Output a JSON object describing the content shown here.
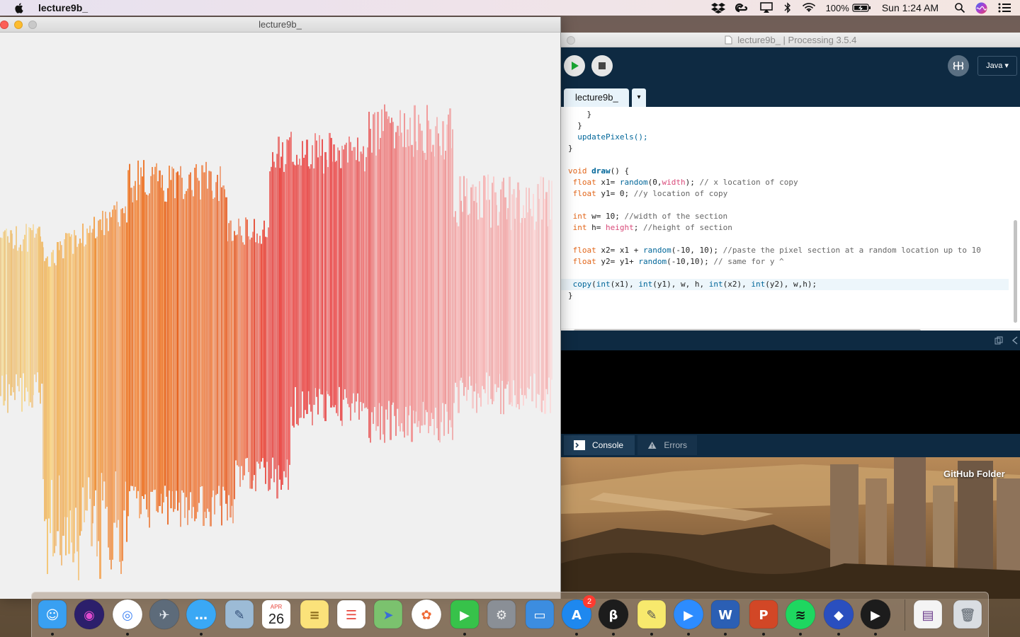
{
  "menubar": {
    "app_name": "lecture9b_",
    "battery": "100%",
    "clock": "Sun 1:24 AM",
    "icons": [
      "dropbox-icon",
      "creative-cloud-icon",
      "airplay-icon",
      "bluetooth-icon",
      "wifi-icon",
      "battery-icon",
      "spotlight-icon",
      "siri-icon",
      "control-center-icon"
    ]
  },
  "sketch_window": {
    "title": "lecture9b_"
  },
  "ide": {
    "title": "lecture9b_ | Processing 3.5.4",
    "mode": "Java ▾",
    "tab_name": "lecture9b_",
    "tab_menu": "▾",
    "code": [
      "    }",
      "  }",
      "  updatePixels();",
      "}",
      "",
      "void draw() {",
      " float x1= random(0,width); // x location of copy",
      " float y1= 0; //y location of copy",
      "",
      " int w= 10; //width of the section",
      " int h= height; //height of section",
      "",
      " float x2= x1 + random(-10, 10); //paste the pixel section at a random location up to 10",
      " float y2= y1+ random(-10,10); // same for y ^",
      "",
      " copy(int(x1), int(y1), w, h, int(x2), int(y2), w,h);",
      "}"
    ],
    "console_tab": "Console",
    "errors_tab": "Errors"
  },
  "desktop": {
    "folder_label": "GitHub Folder"
  },
  "dock": {
    "apps": [
      {
        "name": "Finder",
        "icon": "finder-icon",
        "running": true
      },
      {
        "name": "Siri",
        "icon": "siri-icon",
        "running": false
      },
      {
        "name": "Google Chrome",
        "icon": "chrome-icon",
        "running": true
      },
      {
        "name": "Launchpad",
        "icon": "launchpad-icon",
        "running": false
      },
      {
        "name": "Messages",
        "icon": "messages-icon",
        "running": true
      },
      {
        "name": "Preview",
        "icon": "preview-icon",
        "running": false
      },
      {
        "name": "Calendar",
        "icon": "calendar-icon",
        "running": false,
        "month": "APR",
        "day": "26"
      },
      {
        "name": "Notes",
        "icon": "notes-icon",
        "running": false
      },
      {
        "name": "Reminders",
        "icon": "reminders-icon",
        "running": false
      },
      {
        "name": "Maps",
        "icon": "maps-icon",
        "running": false
      },
      {
        "name": "Photos",
        "icon": "photos-icon",
        "running": false
      },
      {
        "name": "FaceTime",
        "icon": "facetime-icon",
        "running": true
      },
      {
        "name": "System Preferences",
        "icon": "system-preferences-icon",
        "running": false
      },
      {
        "name": "Keynote",
        "icon": "keynote-icon",
        "running": false
      },
      {
        "name": "App Store",
        "icon": "app-store-icon",
        "running": true,
        "badge": "2"
      },
      {
        "name": "Processing",
        "icon": "processing-icon",
        "running": true
      },
      {
        "name": "Stickies",
        "icon": "stickies-icon",
        "running": true
      },
      {
        "name": "Zoom",
        "icon": "zoom-icon",
        "running": true
      },
      {
        "name": "Microsoft Word",
        "icon": "word-icon",
        "running": true
      },
      {
        "name": "Microsoft PowerPoint",
        "icon": "powerpoint-icon",
        "running": true
      },
      {
        "name": "Spotify",
        "icon": "spotify-icon",
        "running": true
      },
      {
        "name": "Dropbox",
        "icon": "dropbox-icon",
        "running": true
      },
      {
        "name": "QuickTime Player",
        "icon": "quicktime-icon",
        "running": true
      },
      {
        "name": "Chrome App Window",
        "icon": "chrome-window-icon",
        "running": false
      },
      {
        "name": "Trash",
        "icon": "trash-icon",
        "running": false
      }
    ]
  }
}
